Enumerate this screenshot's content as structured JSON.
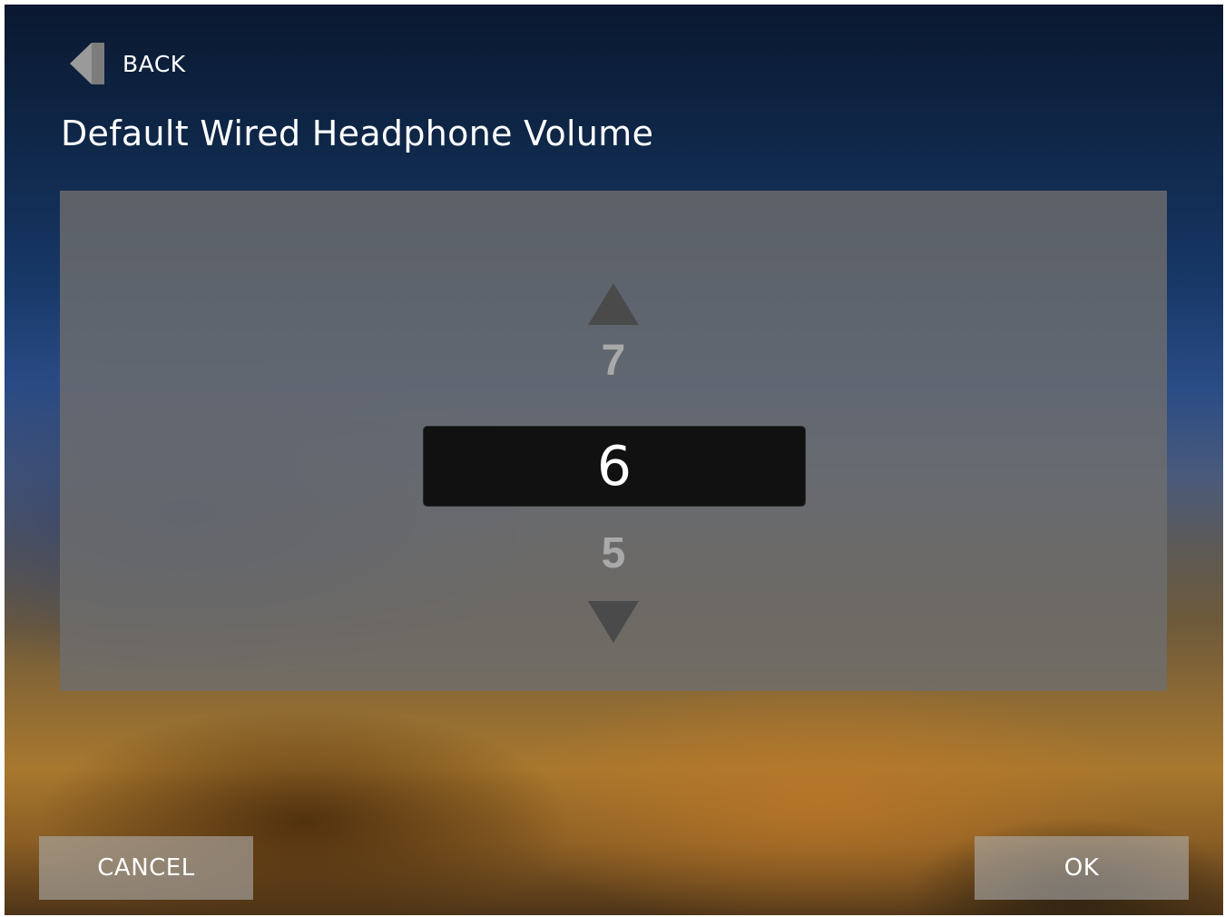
{
  "header": {
    "back_label": "BACK",
    "title": "Default Wired Headphone Volume"
  },
  "picker": {
    "value_above": "7",
    "selected_value": "6",
    "value_below": "5"
  },
  "footer": {
    "cancel_label": "CANCEL",
    "ok_label": "OK"
  },
  "icons": {
    "back": "back-arrow-icon",
    "increase": "triangle-up-icon",
    "decrease": "triangle-down-icon"
  },
  "colors": {
    "selected_bg": "#111111",
    "panel_bg": "#6e6e6e",
    "arrow": "#4a4a4a",
    "text": "#ffffff"
  }
}
